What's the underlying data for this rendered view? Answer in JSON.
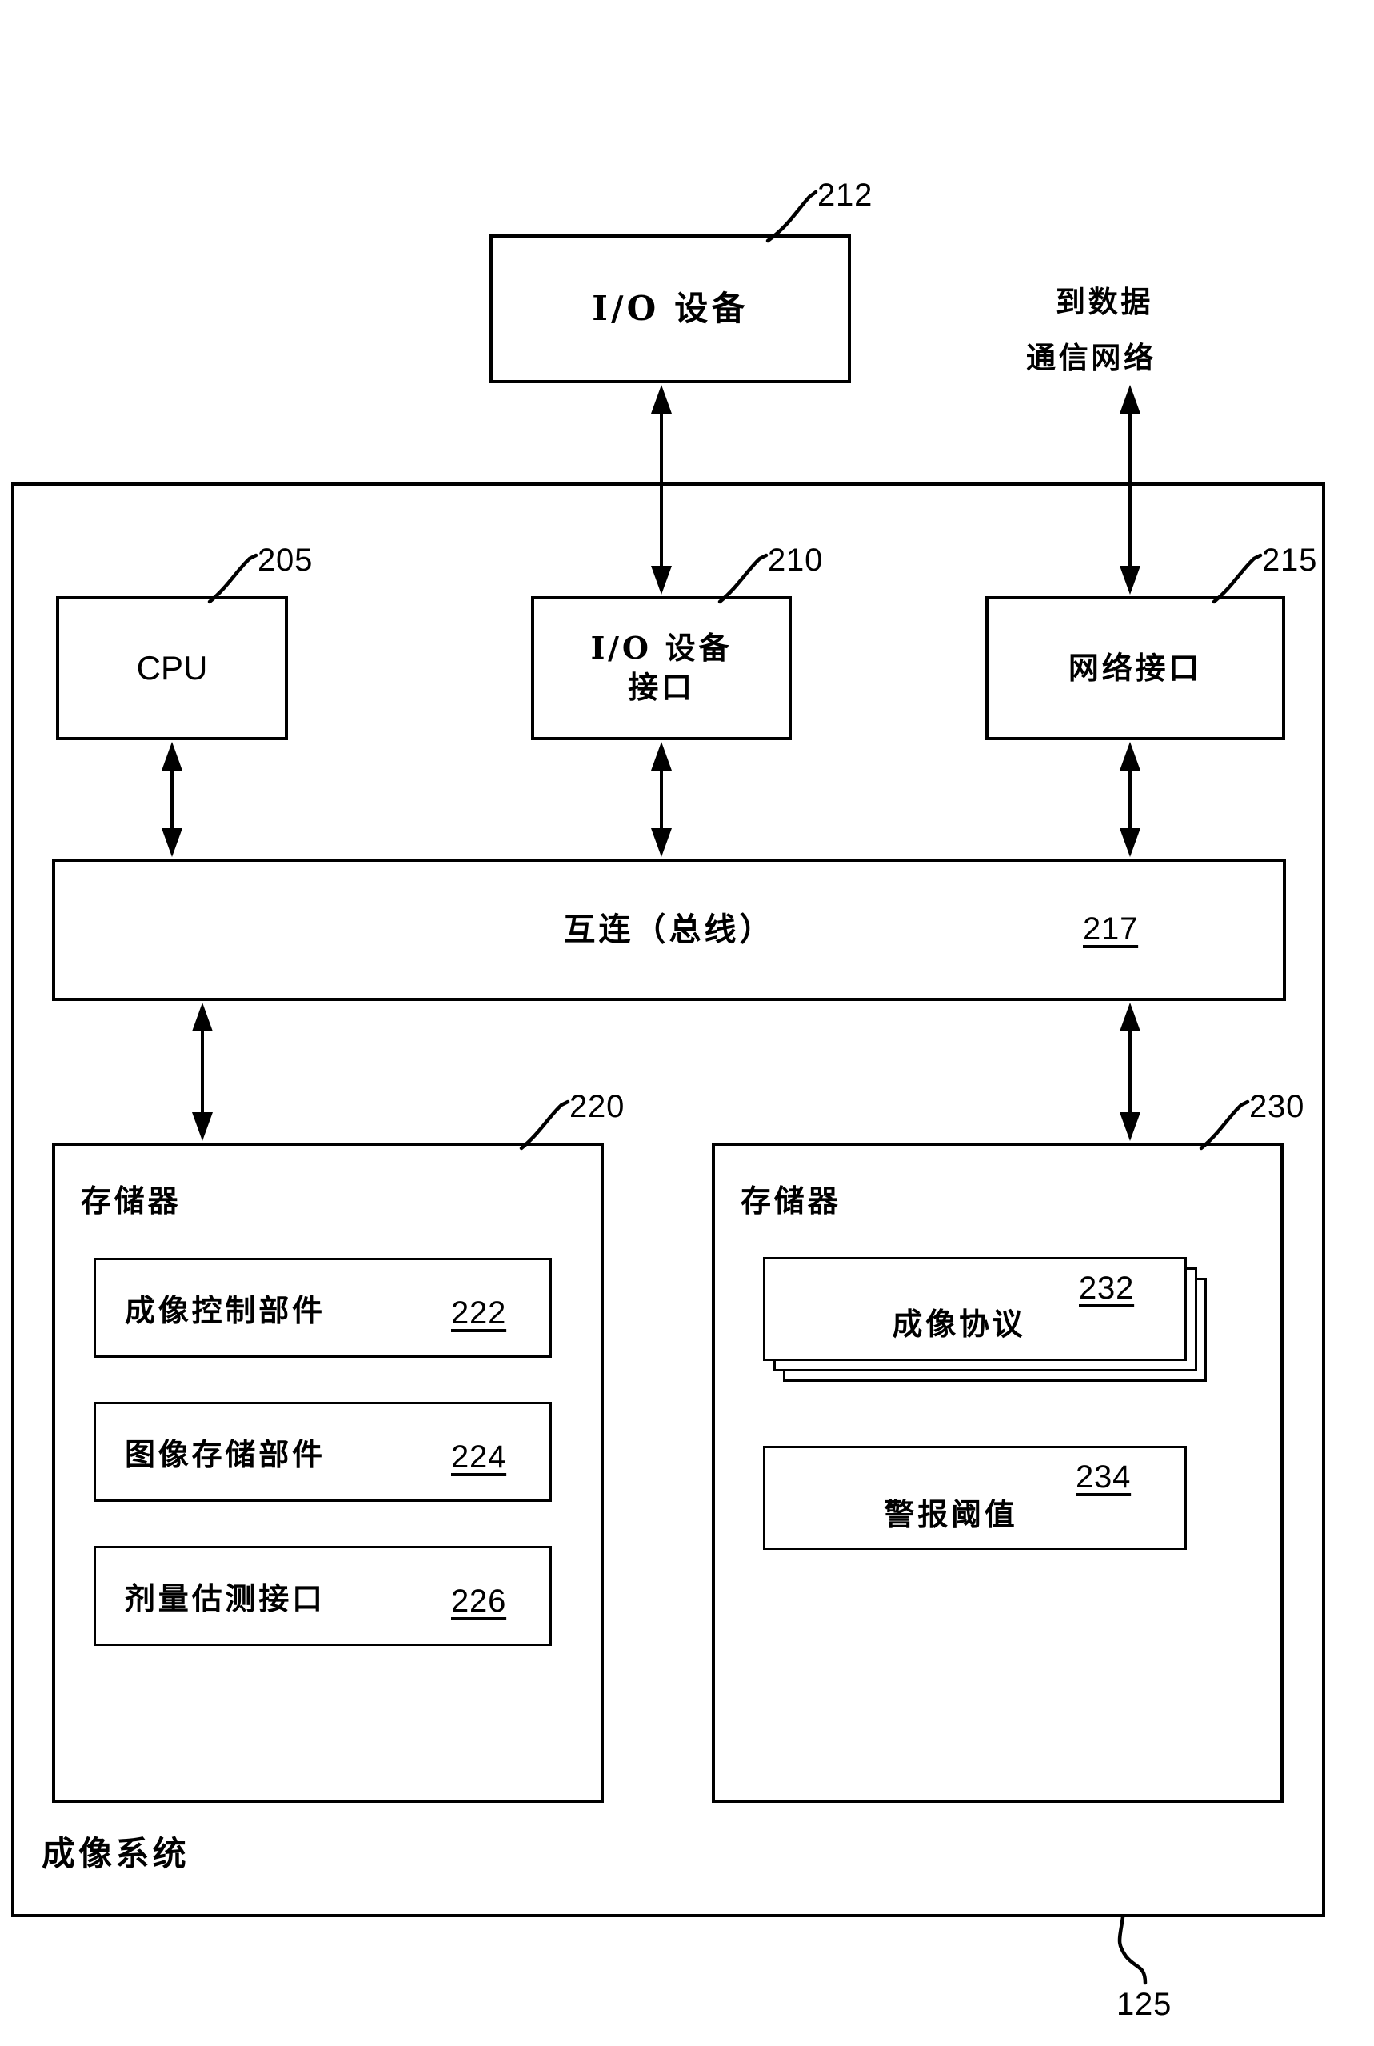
{
  "figure": {
    "system_label": "成像系统",
    "system_ref": "125",
    "network_note_line1": "到数据",
    "network_note_line2": "通信网络"
  },
  "blocks": {
    "io_device_external": {
      "label": "I/O 设备",
      "ref": "212"
    },
    "cpu": {
      "label": "CPU",
      "ref": "205"
    },
    "io_device_interface": {
      "label_line1": "I/O 设备",
      "label_line2": "接口",
      "ref": "210"
    },
    "network_interface": {
      "label": "网络接口",
      "ref": "215"
    },
    "interconnect": {
      "label": "互连（总线）",
      "ref": "217"
    },
    "memory": {
      "label": "存储器",
      "ref": "220",
      "items": [
        {
          "label": "成像控制部件",
          "ref": "222"
        },
        {
          "label": "图像存储部件",
          "ref": "224"
        },
        {
          "label": "剂量估测接口",
          "ref": "226"
        }
      ]
    },
    "storage": {
      "label": "存储器",
      "ref": "230",
      "items": [
        {
          "label": "成像协议",
          "ref": "232",
          "stacked": true
        },
        {
          "label": "警报阈值",
          "ref": "234",
          "stacked": false
        }
      ]
    }
  }
}
